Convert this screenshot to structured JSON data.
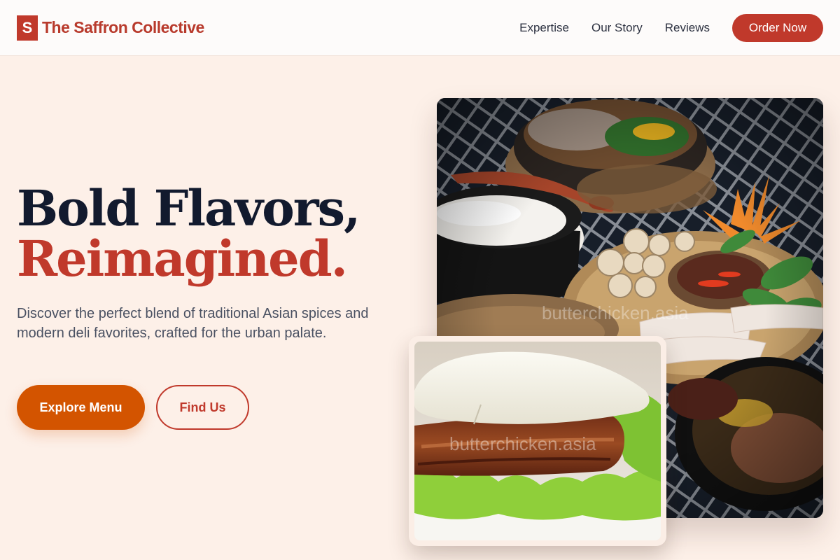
{
  "header": {
    "logo_letter": "S",
    "brand_name": "The Saffron Collective",
    "nav": [
      "Expertise",
      "Our Story",
      "Reviews"
    ],
    "cta_label": "Order Now"
  },
  "hero": {
    "title_line1": "Bold Flavors,",
    "title_line2": "Reimagined.",
    "description": "Discover the perfect blend of traditional Asian spices and modern deli favorites, crafted for the urban palate.",
    "primary_button": "Explore Menu",
    "secondary_button": "Find Us"
  },
  "images": {
    "watermark": "butterchicken.asia"
  },
  "colors": {
    "brand_red": "#c0392b",
    "accent_orange": "#d35400",
    "hero_background": "#fdf0e8",
    "heading_dark": "#121a2e"
  }
}
